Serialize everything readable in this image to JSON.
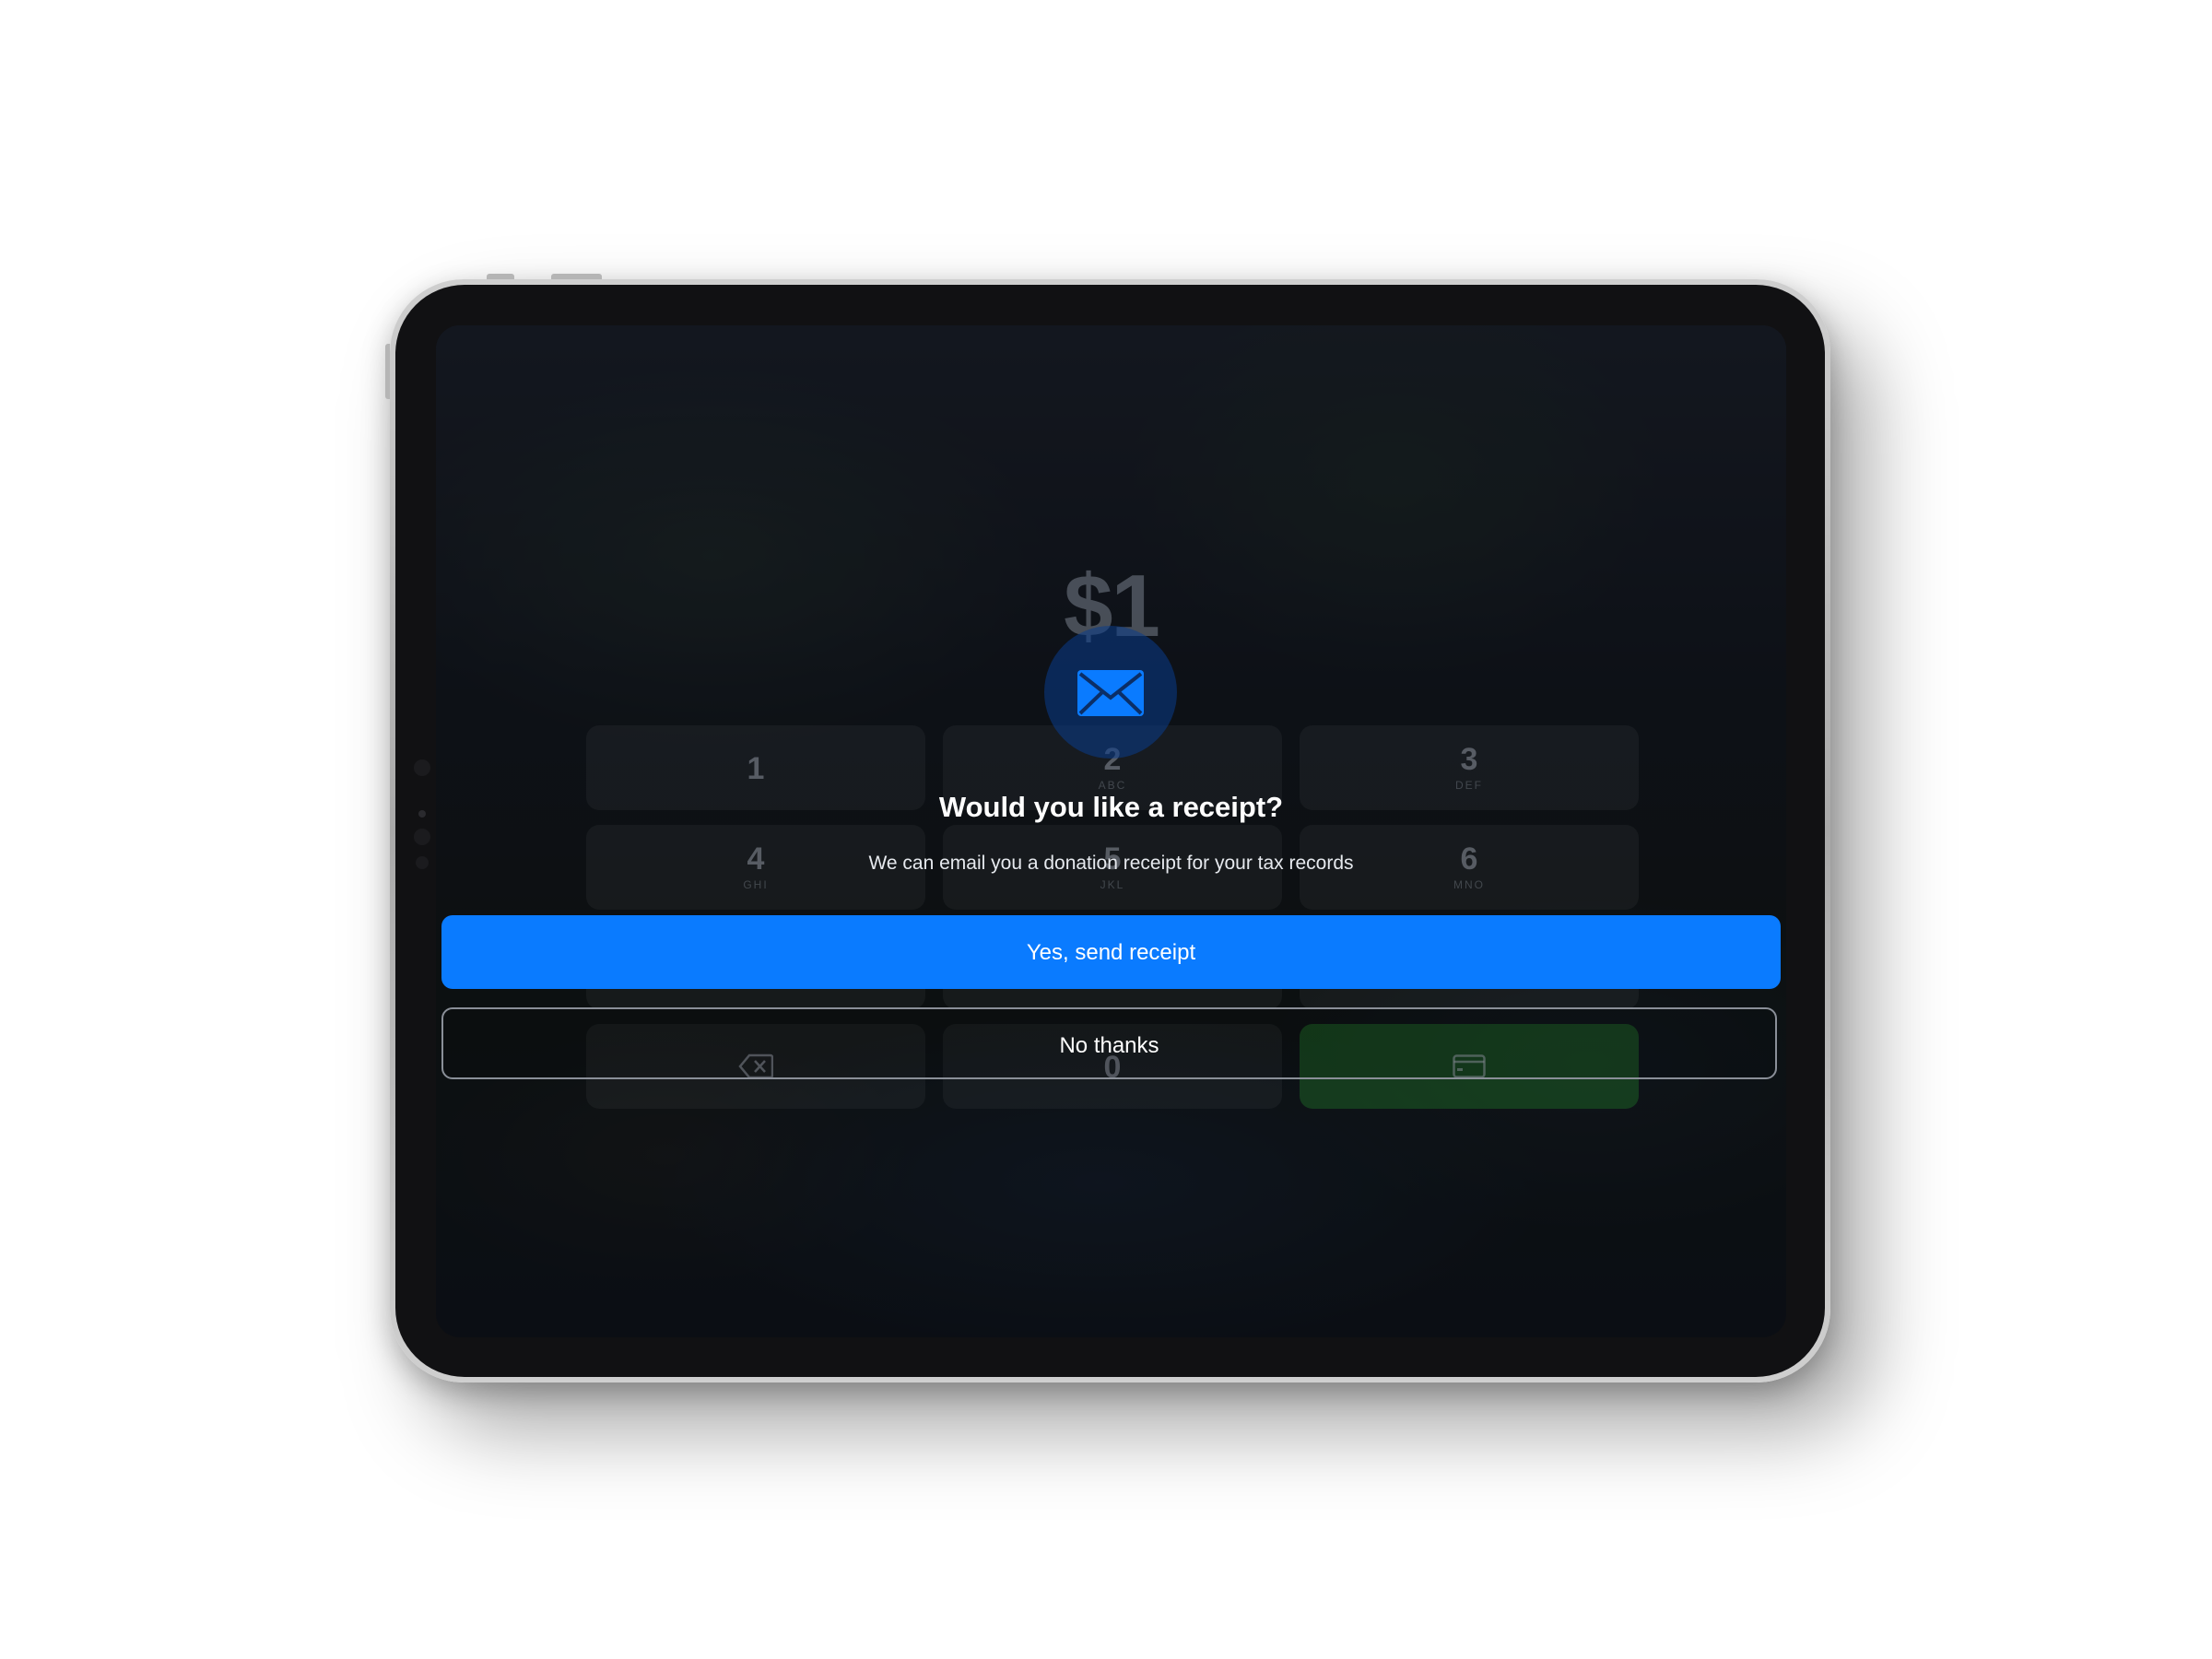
{
  "amount": {
    "value": "$1"
  },
  "keypad": {
    "keys": [
      {
        "digit": "1",
        "letters": ""
      },
      {
        "digit": "2",
        "letters": "ABC"
      },
      {
        "digit": "3",
        "letters": "DEF"
      },
      {
        "digit": "4",
        "letters": "GHI"
      },
      {
        "digit": "5",
        "letters": "JKL"
      },
      {
        "digit": "6",
        "letters": "MNO"
      },
      {
        "digit": "0",
        "letters": ""
      }
    ]
  },
  "receipt_modal": {
    "icon": "envelope-icon",
    "title": "Would you like a receipt?",
    "subtitle": "We can email you a donation receipt for your tax records",
    "yes_label": "Yes, send receipt",
    "no_label": "No thanks"
  },
  "colors": {
    "primary_blue": "#0a7bff",
    "pay_green": "#1e6e28",
    "bezel": "#111113"
  }
}
